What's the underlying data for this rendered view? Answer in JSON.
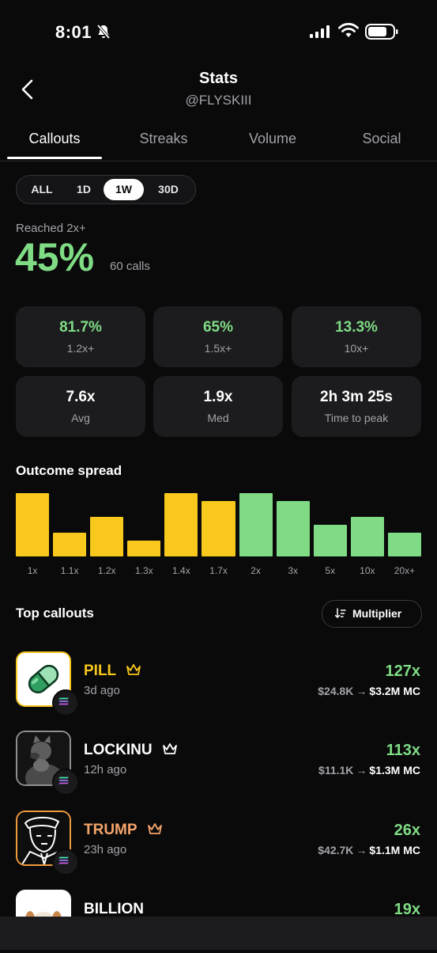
{
  "status": {
    "time": "8:01"
  },
  "header": {
    "title": "Stats",
    "handle": "@FLYSKIII"
  },
  "tabs": [
    {
      "label": "Callouts"
    },
    {
      "label": "Streaks"
    },
    {
      "label": "Volume"
    },
    {
      "label": "Social"
    }
  ],
  "filters": {
    "options": [
      "ALL",
      "1D",
      "1W",
      "30D"
    ],
    "selected": "1W"
  },
  "summary": {
    "label": "Reached 2x+",
    "value": "45%",
    "calls": "60 calls"
  },
  "stats": [
    {
      "value": "81.7%",
      "label": "1.2x+"
    },
    {
      "value": "65%",
      "label": "1.5x+"
    },
    {
      "value": "13.3%",
      "label": "10x+"
    },
    {
      "value": "7.6x",
      "label": "Avg"
    },
    {
      "value": "1.9x",
      "label": "Med"
    },
    {
      "value": "2h 3m 25s",
      "label": "Time to peak"
    }
  ],
  "outcome": {
    "title": "Outcome spread",
    "chart_data": {
      "type": "bar",
      "categories": [
        "1x",
        "1.1x",
        "1.2x",
        "1.3x",
        "1.4x",
        "1.7x",
        "2x",
        "3x",
        "5x",
        "10x",
        "20x+"
      ],
      "values": [
        8,
        3,
        5,
        2,
        8,
        7,
        8,
        7,
        4,
        5,
        3
      ],
      "colors": [
        "#f8c81c",
        "#f8c81c",
        "#f8c81c",
        "#f8c81c",
        "#f8c81c",
        "#f8c81c",
        "#7fdc84",
        "#7fdc84",
        "#7fdc84",
        "#7fdc84",
        "#7fdc84"
      ]
    }
  },
  "top": {
    "title": "Top callouts",
    "sort_label": "Multiplier",
    "items": [
      {
        "name": "PILL",
        "ago": "3d ago",
        "multiplier": "127x",
        "mc_from": "$24.8K",
        "mc_to": "$3.2M MC",
        "name_color": "#f8c81c",
        "border": "#f8c81c",
        "icon": "pill-icon"
      },
      {
        "name": "LOCKINU",
        "ago": "12h ago",
        "multiplier": "113x",
        "mc_from": "$11.1K",
        "mc_to": "$1.3M MC",
        "name_color": "#ffffff",
        "border": "#8e8e93",
        "icon": "dog-icon"
      },
      {
        "name": "TRUMP",
        "ago": "23h ago",
        "multiplier": "26x",
        "mc_from": "$42.7K",
        "mc_to": "$1.1M MC",
        "name_color": "#f4a46a",
        "border": "#f09a3e",
        "icon": "portrait-icon"
      },
      {
        "name": "BILLION",
        "ago": "",
        "multiplier": "19x",
        "mc_from": "",
        "mc_to": "",
        "name_color": "#ffffff",
        "border": "#ffffff",
        "icon": "puppy-icon"
      }
    ]
  }
}
